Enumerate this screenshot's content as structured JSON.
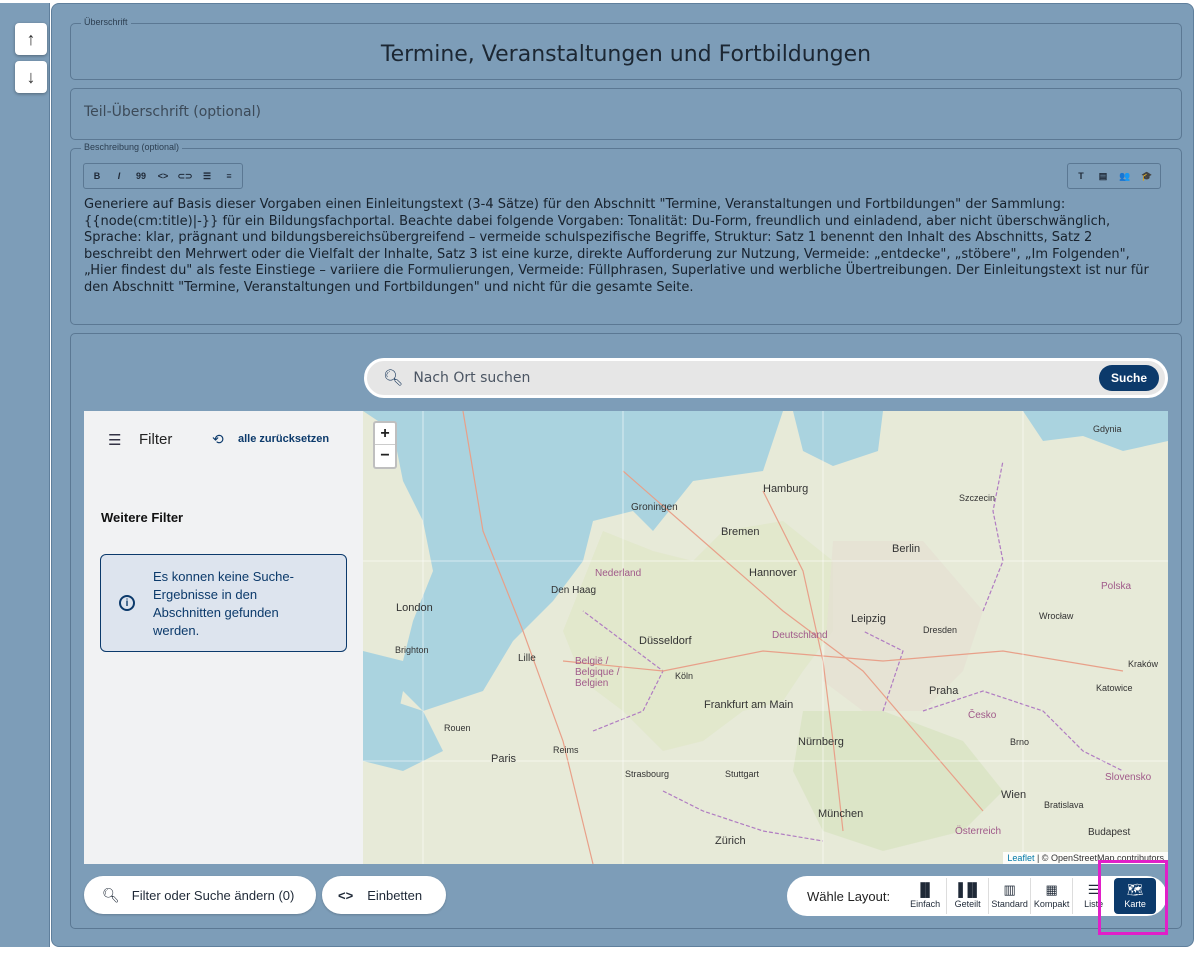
{
  "controls": {
    "move_up_icon": "↑",
    "move_down_icon": "↓"
  },
  "heading": {
    "legend": "Überschrift",
    "value": "Termine, Veranstaltungen und Fortbildungen"
  },
  "subheading": {
    "placeholder": "Teil-Überschrift (optional)"
  },
  "description": {
    "legend": "Beschreibung (optional)",
    "text": "Generiere auf Basis dieser Vorgaben einen Einleitungstext (3-4 Sätze) für den Abschnitt \"Termine, Veranstaltungen und Fortbildungen\" der Sammlung: {{node(cm:title)|-}} für ein Bildungsfachportal. Beachte dabei folgende Vorgaben: Tonalität: Du-Form, freundlich und einladend, aber nicht überschwänglich, Sprache: klar, prägnant und bildungsbereichsübergreifend – vermeide schulspezifische Begriffe, Struktur: Satz 1 benennt den Inhalt des Abschnitts, Satz 2 beschreibt den Mehrwert oder die Vielfalt der Inhalte, Satz 3 ist eine kurze, direkte Aufforderung zur Nutzung, Vermeide: „entdecke\", „stöbere\", „Im Folgenden\", „Hier findest du\" als feste Einstiege – variiere die Formulierungen, Vermeide: Füllphrasen, Superlative und werbliche Übertreibungen. Der Einleitungstext ist nur für den Abschnitt \"Termine, Veranstaltungen und Fortbildungen\" und nicht für die gesamte Seite.",
    "toolbar_left": [
      "B",
      "I",
      "99",
      "<>",
      "⊂⊃",
      "☰",
      "≡"
    ],
    "toolbar_right": [
      "T",
      "▤",
      "👥",
      "🎓"
    ]
  },
  "search": {
    "placeholder": "Nach Ort suchen",
    "button": "Suche"
  },
  "filter": {
    "title": "Filter",
    "reset": "alle zurücksetzen",
    "more_filters": "Weitere Filter",
    "no_results": "Es konnen keine Suche-Ergebnisse in den Abschnitten gefunden werden."
  },
  "map": {
    "attribution_leaflet": "Leaflet",
    "attribution_osm": "| © OpenStreetMap contributors",
    "zoom_in": "+",
    "zoom_out": "−",
    "labels": {
      "hamburg": "Hamburg",
      "bremen": "Bremen",
      "berlin": "Berlin",
      "hannover": "Hannover",
      "leipzig": "Leipzig",
      "deutschland": "Deutschland",
      "nederland": "Nederland",
      "london": "London",
      "paris": "Paris",
      "praha": "Praha",
      "polska": "Polska",
      "frankfurt": "Frankfurt am Main",
      "nurnberg": "Nürnberg",
      "munchen": "München",
      "wien": "Wien",
      "zurich": "Zürich",
      "dusseldorf": "Düsseldorf",
      "belgie": "België / Belgique / Belgien",
      "cesko": "Česko",
      "osterreich": "Österreich",
      "slovensko": "Slovensko",
      "budapest": "Budapest",
      "lille": "Lille",
      "groningen": "Groningen",
      "den_haag": "Den Haag",
      "brighton": "Brighton",
      "koln": "Köln",
      "dresden": "Dresden",
      "stuttgart": "Stuttgart",
      "strasbourg": "Strasbourg",
      "bratislava": "Bratislava",
      "katowice": "Katowice",
      "brno": "Brno",
      "reims": "Reims",
      "rouen": "Rouen",
      "gdynia": "Gdynia",
      "szczecin": "Szczecin",
      "wroclaw": "Wrocław",
      "krakow": "Kraków"
    }
  },
  "bottom": {
    "filter_button": "Filter oder Suche ändern (0)",
    "embed_button": "Einbetten",
    "layout_label": "Wähle Layout:",
    "layouts": [
      "Einfach",
      "Geteilt",
      "Standard",
      "Kompakt",
      "Liste",
      "Karte"
    ]
  },
  "colors": {
    "panel": "#7d9db8",
    "accent": "#0c3a6b",
    "highlight": "#e11fc8",
    "water": "#aad3df"
  }
}
